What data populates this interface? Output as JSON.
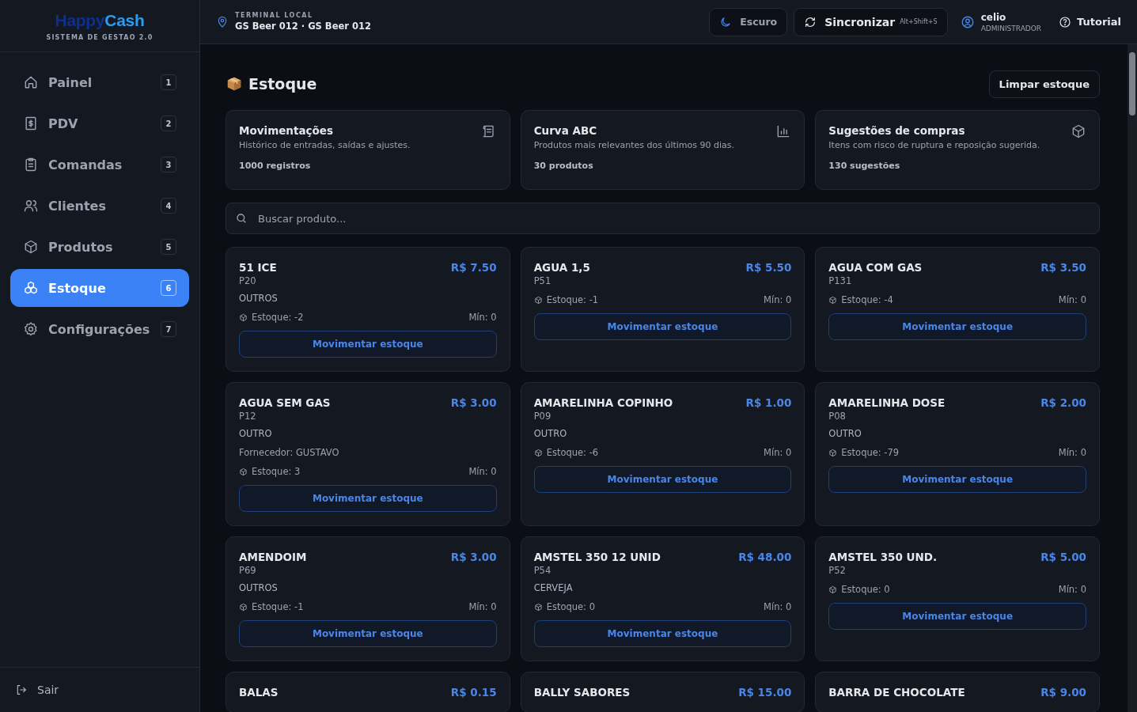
{
  "brand": {
    "logo_first": "Happy",
    "logo_second": "Cash",
    "subtitle": "SISTEMA DE GESTAO 2.0"
  },
  "sidebar": {
    "items": [
      {
        "label": "Painel",
        "shortcut": "1",
        "selected": false
      },
      {
        "label": "PDV",
        "shortcut": "2",
        "selected": false
      },
      {
        "label": "Comandas",
        "shortcut": "3",
        "selected": false
      },
      {
        "label": "Clientes",
        "shortcut": "4",
        "selected": false
      },
      {
        "label": "Produtos",
        "shortcut": "5",
        "selected": false
      },
      {
        "label": "Estoque",
        "shortcut": "6",
        "selected": true
      },
      {
        "label": "Configurações",
        "shortcut": "7",
        "selected": false
      }
    ],
    "logout": "Sair"
  },
  "header": {
    "terminal_label": "TERMINAL LOCAL",
    "terminal_name": "GS Beer 012 · GS Beer 012",
    "theme_button": "Escuro",
    "sync_button": "Sincronizar",
    "sync_shortcut": "Alt+Shift+S",
    "user_name": "celio",
    "user_role": "ADMINISTRADOR",
    "tutorial_button": "Tutorial"
  },
  "page": {
    "title": "Estoque",
    "clear_button": "Limpar estoque"
  },
  "summary_cards": [
    {
      "title": "Movimentações",
      "description": "Histórico de entradas, saídas e ajustes.",
      "count": "1000 registros"
    },
    {
      "title": "Curva ABC",
      "description": "Produtos mais relevantes dos últimos 90 dias.",
      "count": "30 produtos"
    },
    {
      "title": "Sugestões de compras",
      "description": "Itens com risco de ruptura e reposição sugerida.",
      "count": "130 sugestões"
    }
  ],
  "search": {
    "placeholder": "Buscar produto..."
  },
  "products": [
    {
      "name": "51 ICE",
      "price": "R$ 7.50",
      "code": "P20",
      "category": "OUTROS",
      "stock": "Estoque: -2",
      "min": "Mín: 0",
      "button": "Movimentar estoque"
    },
    {
      "name": "AGUA 1,5",
      "price": "R$ 5.50",
      "code": "P51",
      "stock": "Estoque: -1",
      "min": "Mín: 0",
      "button": "Movimentar estoque"
    },
    {
      "name": "AGUA COM GAS",
      "price": "R$ 3.50",
      "code": "P131",
      "stock": "Estoque: -4",
      "min": "Mín: 0",
      "button": "Movimentar estoque"
    },
    {
      "name": "AGUA SEM GAS",
      "price": "R$ 3.00",
      "code": "P12",
      "category": "OUTRO",
      "supplier": "Fornecedor: GUSTAVO",
      "stock": "Estoque: 3",
      "min": "Mín: 0",
      "button": "Movimentar estoque"
    },
    {
      "name": "AMARELINHA COPINHO",
      "price": "R$ 1.00",
      "code": "P09",
      "category": "OUTRO",
      "stock": "Estoque: -6",
      "min": "Mín: 0",
      "button": "Movimentar estoque"
    },
    {
      "name": "AMARELINHA DOSE",
      "price": "R$ 2.00",
      "code": "P08",
      "category": "OUTRO",
      "stock": "Estoque: -79",
      "min": "Mín: 0",
      "button": "Movimentar estoque"
    },
    {
      "name": "AMENDOIM",
      "price": "R$ 3.00",
      "code": "P69",
      "category": "OUTROS",
      "stock": "Estoque: -1",
      "min": "Mín: 0",
      "button": "Movimentar estoque"
    },
    {
      "name": "AMSTEL 350 12 UNID",
      "price": "R$ 48.00",
      "code": "P54",
      "category": "CERVEJA",
      "stock": "Estoque: 0",
      "min": "Mín: 0",
      "button": "Movimentar estoque"
    },
    {
      "name": "AMSTEL 350 UND.",
      "price": "R$ 5.00",
      "code": "P52",
      "stock": "Estoque: 0",
      "min": "Mín: 0",
      "button": "Movimentar estoque"
    },
    {
      "name": "BALAS",
      "price": "R$ 0.15"
    },
    {
      "name": "BALLY SABORES",
      "price": "R$ 15.00"
    },
    {
      "name": "BARRA DE CHOCOLATE",
      "price": "R$ 9.00"
    }
  ]
}
